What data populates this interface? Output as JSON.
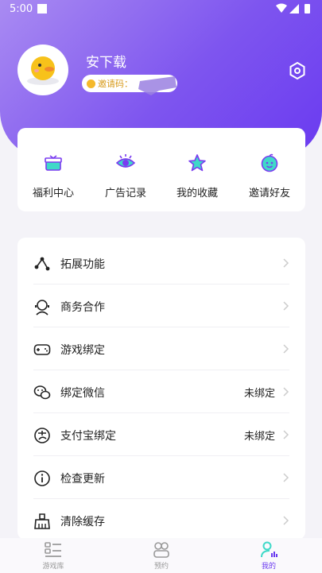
{
  "status_bar": {
    "time": "5:00"
  },
  "profile": {
    "username": "安下载",
    "invite_label": "邀请码："
  },
  "quick_actions": [
    {
      "label": "福利中心",
      "icon": "gift-icon"
    },
    {
      "label": "广告记录",
      "icon": "eye-icon"
    },
    {
      "label": "我的收藏",
      "icon": "star-icon"
    },
    {
      "label": "邀请好友",
      "icon": "invite-icon"
    }
  ],
  "menu": [
    {
      "label": "拓展功能",
      "value": "",
      "icon": "share-nodes-icon"
    },
    {
      "label": "商务合作",
      "value": "",
      "icon": "headset-icon"
    },
    {
      "label": "游戏绑定",
      "value": "",
      "icon": "gamepad-icon"
    },
    {
      "label": "绑定微信",
      "value": "未绑定",
      "icon": "wechat-icon"
    },
    {
      "label": "支付宝绑定",
      "value": "未绑定",
      "icon": "alipay-icon"
    },
    {
      "label": "检查更新",
      "value": "",
      "icon": "info-icon"
    },
    {
      "label": "清除缓存",
      "value": "",
      "icon": "broom-icon"
    }
  ],
  "tabs": [
    {
      "label": "游戏库",
      "icon": "library-icon",
      "active": false
    },
    {
      "label": "预约",
      "icon": "reserve-icon",
      "active": false
    },
    {
      "label": "我的",
      "icon": "user-icon",
      "active": true
    }
  ],
  "colors": {
    "accent": "#6a3af0",
    "header_start": "#a98bf2",
    "header_end": "#6a3af0"
  }
}
